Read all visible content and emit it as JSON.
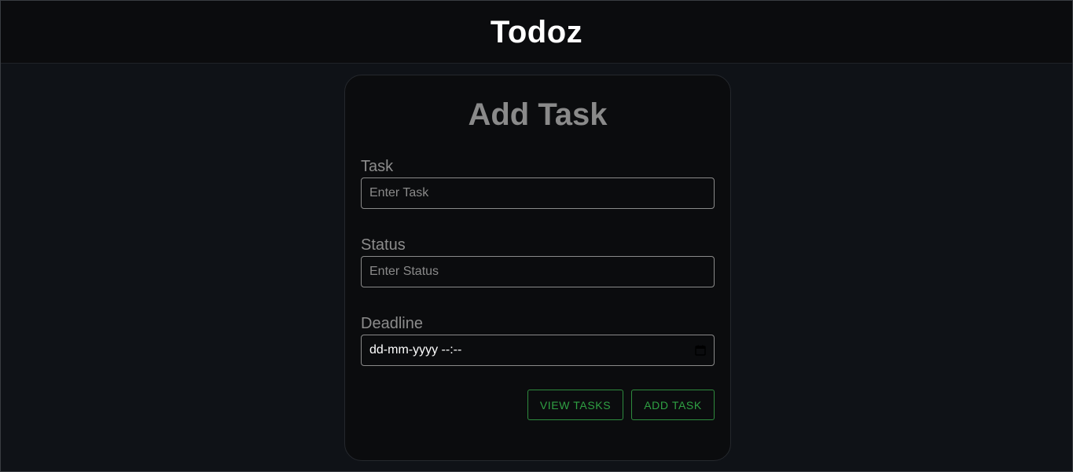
{
  "app": {
    "title": "Todoz"
  },
  "form": {
    "title": "Add Task",
    "task": {
      "label": "Task",
      "placeholder": "Enter Task",
      "value": ""
    },
    "status": {
      "label": "Status",
      "placeholder": "Enter Status",
      "value": ""
    },
    "deadline": {
      "label": "Deadline",
      "display": "dd-mm-yyyy --:--"
    },
    "buttons": {
      "view_tasks": "VIEW TASKS",
      "add_task": "ADD TASK"
    }
  },
  "icons": {
    "deadline_picker": "calendar-icon"
  },
  "colors": {
    "page_background": "#0f1217",
    "navbar_background": "#0b0c0e",
    "card_background": "#0b0c0e",
    "muted_text": "#8a8a8a",
    "accent_green": "#2fa043"
  }
}
